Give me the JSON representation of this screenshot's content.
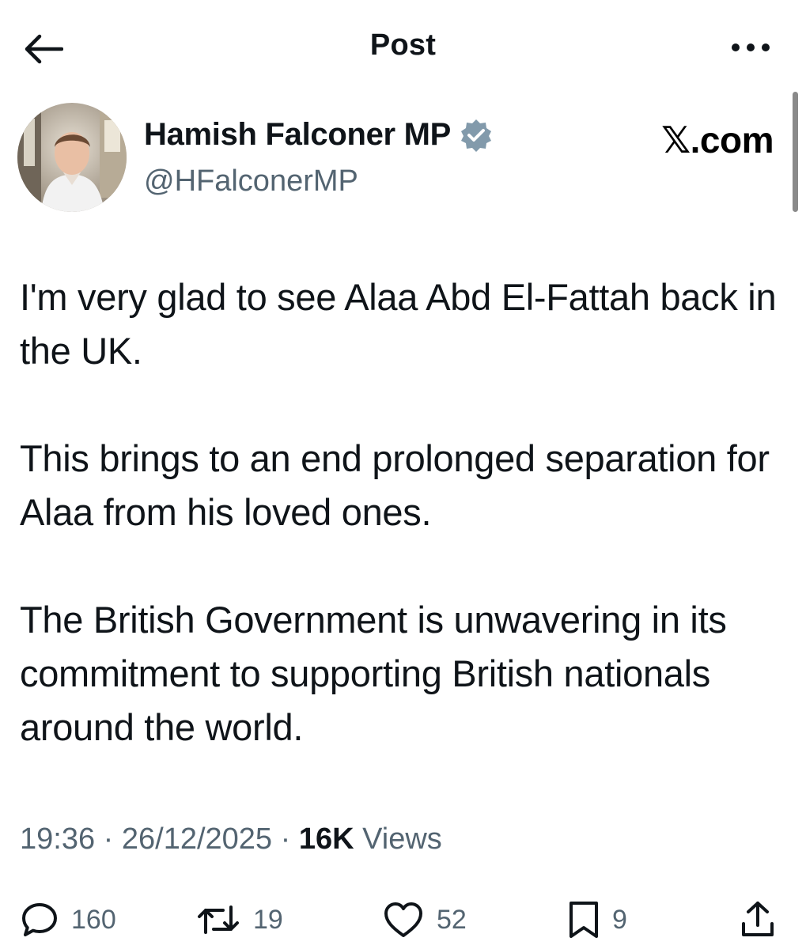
{
  "header": {
    "title": "Post"
  },
  "author": {
    "name": "Hamish Falconer MP",
    "handle": "@HFalconerMP"
  },
  "watermark": "𝕏.com",
  "post": {
    "paragraphs": [
      "I'm very glad to see Alaa Abd El-Fattah back in the UK.",
      "This brings to an end prolonged separation for Alaa from his loved ones.",
      "The British Government is unwavering in its commitment to supporting British nationals around the world."
    ],
    "time": "19:36",
    "date": "26/12/2025",
    "views_count": "16K",
    "views_label": "Views"
  },
  "stats": {
    "replies": "160",
    "reposts": "19",
    "likes": "52",
    "bookmarks": "9"
  },
  "icons": {
    "back": "arrow-left-icon",
    "more": "more-dots-icon",
    "verified": "verified-badge-icon",
    "reply": "reply-bubble-icon",
    "repost": "repost-icon",
    "like": "heart-icon",
    "bookmark": "bookmark-icon",
    "share": "share-icon"
  },
  "colors": {
    "text": "#0f1419",
    "secondary": "#536471",
    "verified": "#829aab"
  }
}
